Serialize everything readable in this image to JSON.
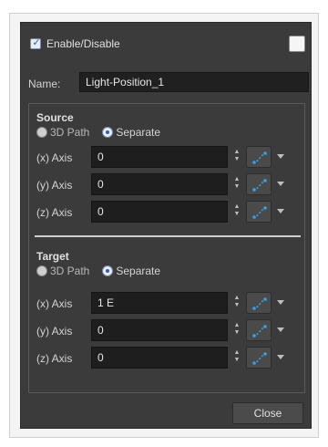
{
  "header": {
    "enable_label": "Enable/Disable",
    "enable_checked": true,
    "swatch_color": "#f5f5f5"
  },
  "name": {
    "label": "Name:",
    "value": "Light-Position_1"
  },
  "source": {
    "title": "Source",
    "radio_3d": "3D Path",
    "radio_separate": "Separate",
    "selected": "Separate",
    "axes": [
      {
        "label": "(x) Axis",
        "value": "0"
      },
      {
        "label": "(y) Axis",
        "value": "0"
      },
      {
        "label": "(z) Axis",
        "value": "0"
      }
    ]
  },
  "target": {
    "title": "Target",
    "radio_3d": "3D Path",
    "radio_separate": "Separate",
    "selected": "Separate",
    "axes": [
      {
        "label": "(x) Axis",
        "value": "1 E"
      },
      {
        "label": "(y) Axis",
        "value": "0"
      },
      {
        "label": "(z) Axis",
        "value": "0"
      }
    ]
  },
  "footer": {
    "close_label": "Close"
  },
  "icons": {
    "function": "function-curve-icon",
    "spinner": "spinner-arrows-icon",
    "dropdown": "chevron-down-icon"
  },
  "colors": {
    "dialog_bg": "#3b3b3b",
    "field_bg": "#1e1e1e",
    "accent": "#2f5fb0"
  }
}
